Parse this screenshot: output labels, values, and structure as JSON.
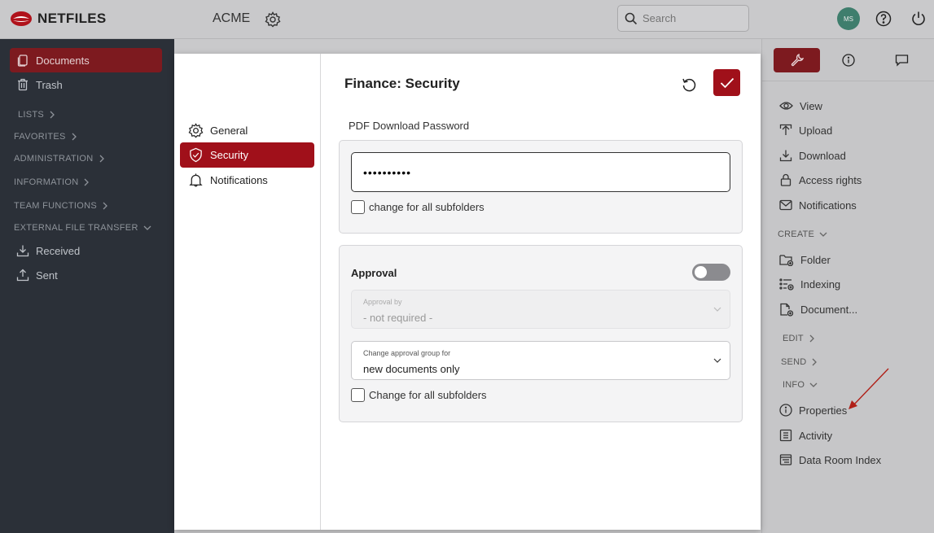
{
  "app": {
    "logo_text": "NETFILES",
    "org_name": "ACME"
  },
  "search": {
    "placeholder": "Search"
  },
  "user": {
    "initials": "MS"
  },
  "colors": {
    "accent": "#a0101a",
    "sidebar_bg": "#2b3038",
    "avatar": "#3f7e6d"
  },
  "sidebar": {
    "documents": "Documents",
    "trash": "Trash",
    "lists": "LISTS",
    "favorites": "FAVORITES",
    "administration": "ADMINISTRATION",
    "information": "INFORMATION",
    "team_functions": "TEAM FUNCTIONS",
    "external_file_transfer": "EXTERNAL FILE TRANSFER",
    "received": "Received",
    "sent": "Sent"
  },
  "right_panel": {
    "view": "View",
    "upload": "Upload",
    "download": "Download",
    "access_rights": "Access rights",
    "notifications": "Notifications",
    "create": "CREATE",
    "folder": "Folder",
    "indexing": "Indexing",
    "document": "Document...",
    "edit": "EDIT",
    "send": "SEND",
    "info": "INFO",
    "properties": "Properties",
    "activity": "Activity",
    "data_room_index": "Data Room Index"
  },
  "modal": {
    "title": "Finance: Security",
    "nav": {
      "general": "General",
      "security": "Security",
      "notifications": "Notifications"
    },
    "pdf_password": {
      "label": "PDF Download Password",
      "value": "••••••••••",
      "subfolders": "change for all subfolders"
    },
    "approval": {
      "label": "Approval",
      "enabled": false,
      "approval_by_label": "Approval by",
      "approval_by_value": "- not required -",
      "group_label": "Change approval group for",
      "group_value": "new documents only",
      "subfolders": "Change for all subfolders"
    }
  }
}
